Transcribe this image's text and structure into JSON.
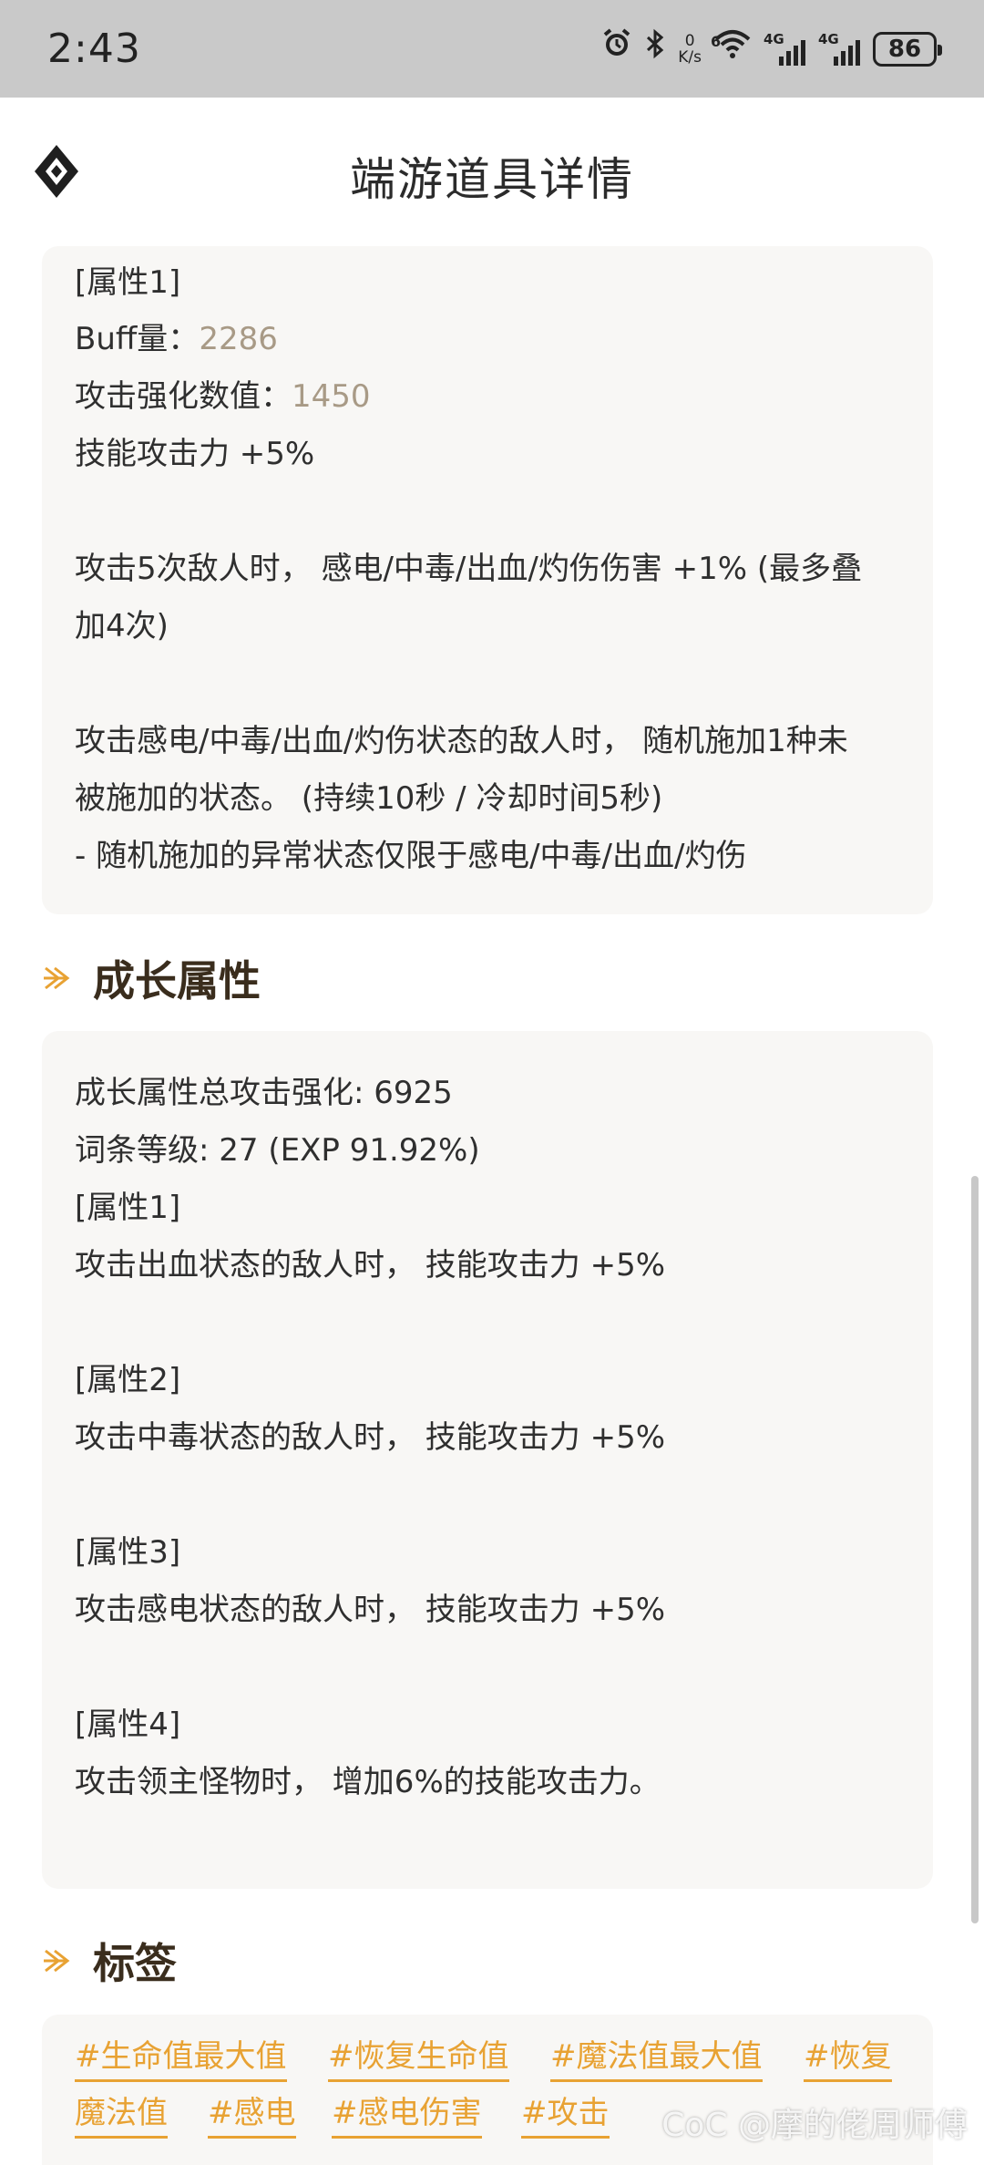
{
  "status_bar": {
    "time": "2:43",
    "net_speed_value": "0",
    "net_speed_unit": "K/s",
    "wifi_badge": "6",
    "signal1": "4G",
    "signal2": "4G",
    "battery": "86",
    "icons": [
      "alarm-icon",
      "bluetooth-icon",
      "wifi-icon",
      "signal-icon",
      "battery-icon"
    ]
  },
  "header": {
    "title": "端游道具详情",
    "logo_icon": "diamond-logo-icon"
  },
  "card1": {
    "lines": [
      "[属性1]",
      "Buff量：",
      "攻击强化数值：",
      "技能攻击力 +5%",
      "攻击5次敌人时， 感电/中毒/出血/灼伤伤害 +1% (最多叠",
      "加4次)",
      "攻击感电/中毒/出血/灼伤状态的敌人时， 随机施加1种未",
      "被施加的状态。 (持续10秒 / 冷却时间5秒)",
      "- 随机施加的异常状态仅限于感电/中毒/出血/灼伤"
    ],
    "buff_value": "2286",
    "attack_value": "1450"
  },
  "growth": {
    "title": "成长属性",
    "lines": [
      "成长属性总攻击强化: 6925",
      "词条等级: 27 (EXP 91.92%)",
      "[属性1]",
      "攻击出血状态的敌人时， 技能攻击力 +5%",
      "[属性2]",
      "攻击中毒状态的敌人时， 技能攻击力 +5%",
      "[属性3]",
      "攻击感电状态的敌人时， 技能攻击力 +5%",
      "[属性4]",
      "攻击领主怪物时， 增加6%的技能攻击力。"
    ]
  },
  "tags": {
    "title": "标签",
    "items": [
      "#生命值最大值",
      "#恢复生命值",
      "#魔法值最大值",
      "#恢复",
      "魔法值",
      "#感电",
      "#感电伤害",
      "#攻击"
    ]
  },
  "watermark": "CoC @摩的佬周师傅",
  "colors": {
    "accent": "#e8a233",
    "value_text": "#a89a86",
    "card_bg": "#f8f7f5",
    "status_bar_bg": "#c9c9c9"
  }
}
